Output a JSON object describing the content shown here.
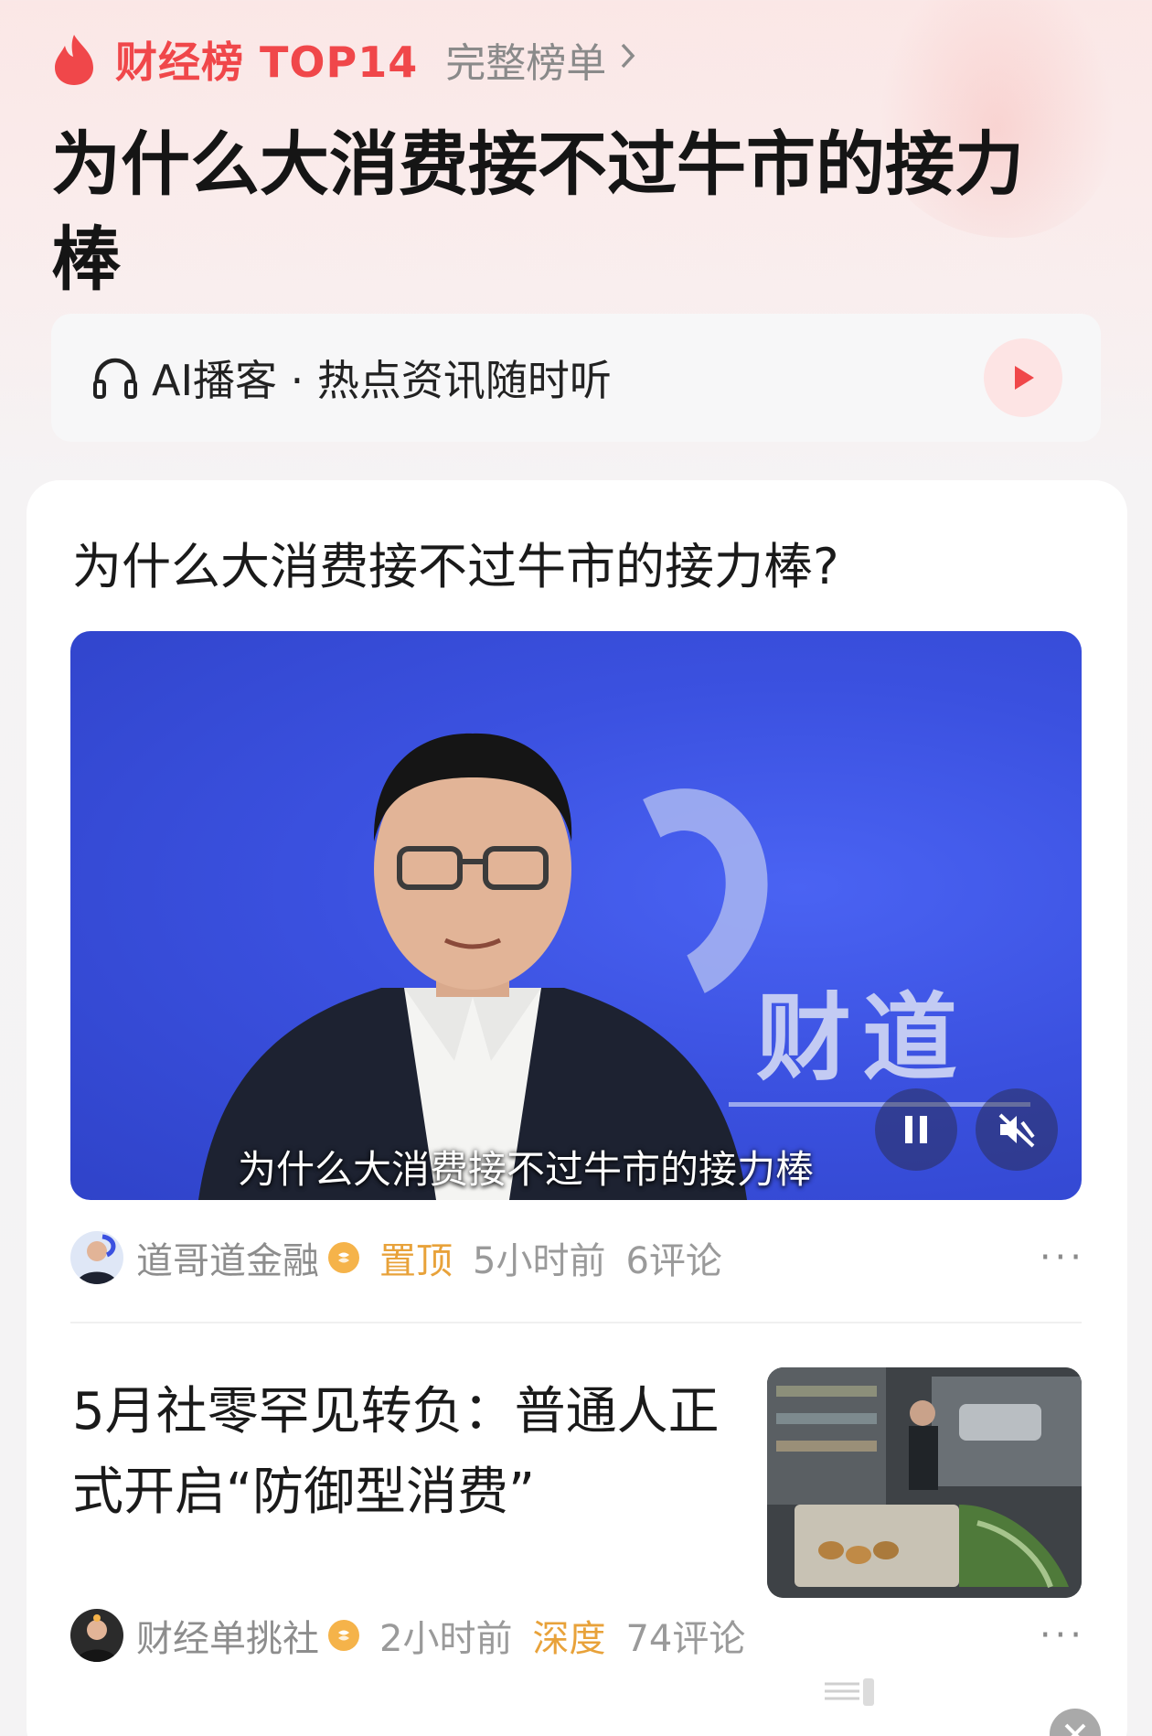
{
  "header": {
    "rank_title": "财经榜 TOP14",
    "full_list_label": "完整榜单",
    "page_title": "为什么大消费接不过牛市的接力棒"
  },
  "podcast": {
    "label": "AI播客 · 热点资讯随时听"
  },
  "video_post": {
    "title": "为什么大消费接不过牛市的接力棒?",
    "brand_text": "财道",
    "subtitle": "为什么大消费接不过牛市的接力棒",
    "author": "道哥道金融",
    "tag": "置顶",
    "time": "5小时前",
    "comments": "6评论",
    "more": "···"
  },
  "news_post": {
    "title": "5月社零罕见转负：普通人正式开启“防御型消费”",
    "author": "财经单挑社",
    "time": "2小时前",
    "tag": "深度",
    "comments": "74评论",
    "more": "···"
  },
  "icons": {
    "flame": "flame-icon",
    "chevron": "chevron-right-icon",
    "headphone": "headphone-icon",
    "play": "play-icon",
    "pause": "pause-icon",
    "mute": "mute-icon",
    "verified": "verified-badge-icon",
    "close": "close-icon"
  },
  "colors": {
    "accent_red": "#f0474a",
    "tag_orange": "#e8a23a",
    "video_blue": "#3b51e0"
  }
}
